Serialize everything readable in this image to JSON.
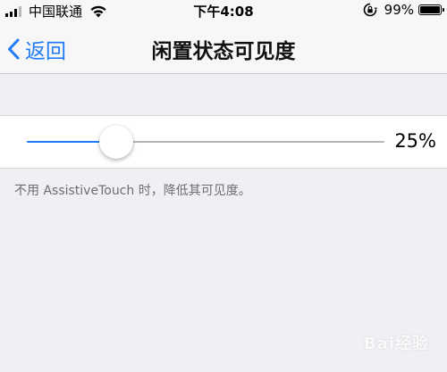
{
  "status_bar": {
    "carrier": "中国联通",
    "time": "下午4:08",
    "battery_percent": "99%",
    "battery_level": 0.99,
    "icons": [
      "signal-icon",
      "wifi-icon",
      "rotation-lock-icon",
      "battery-icon"
    ]
  },
  "nav": {
    "back_label": "返回",
    "title": "闲置状态可见度"
  },
  "slider": {
    "value": 0.25,
    "value_label": "25%",
    "accent_color": "#1f7bf6"
  },
  "footer_note": "不用 AssistiveTouch 时，降低其可见度。",
  "watermark": "Bai经验"
}
